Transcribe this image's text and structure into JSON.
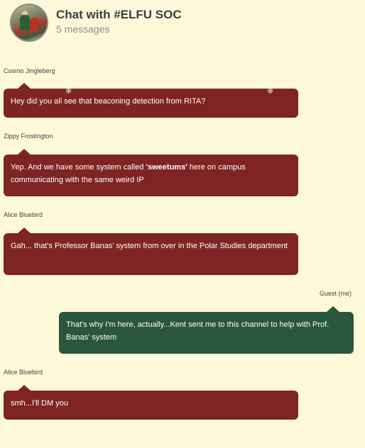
{
  "header": {
    "title": "Chat with #ELFU SOC",
    "subtitle": "5 messages"
  },
  "messages": [
    {
      "sender": "Cosmo Jingleberg",
      "text": "Hey did you all see that beaconing detection from RITA?",
      "side": "them"
    },
    {
      "sender": "Zippy Frostington",
      "text_before": "Yep. And we have some system called ",
      "bold": "'sweetums'",
      "text_after": " here on campus communicating with the same weird IP",
      "side": "them"
    },
    {
      "sender": "Alice Bluebird",
      "text": "Gah... that's Professor Banas' system from over in the Polar Studies department",
      "side": "them"
    },
    {
      "sender": "Guest (me)",
      "text": "That's why I'm here, actually...Kent sent me to this channel to help with Prof. Banas' system",
      "side": "me"
    },
    {
      "sender": "Alice Bluebird",
      "text": "smh...I'll DM you",
      "side": "them"
    }
  ],
  "decor": {
    "snowflake_icon": "❄"
  },
  "colors": {
    "background": "#fcf8d8",
    "them_bubble": "#7e2423",
    "me_bubble": "#29573b"
  }
}
